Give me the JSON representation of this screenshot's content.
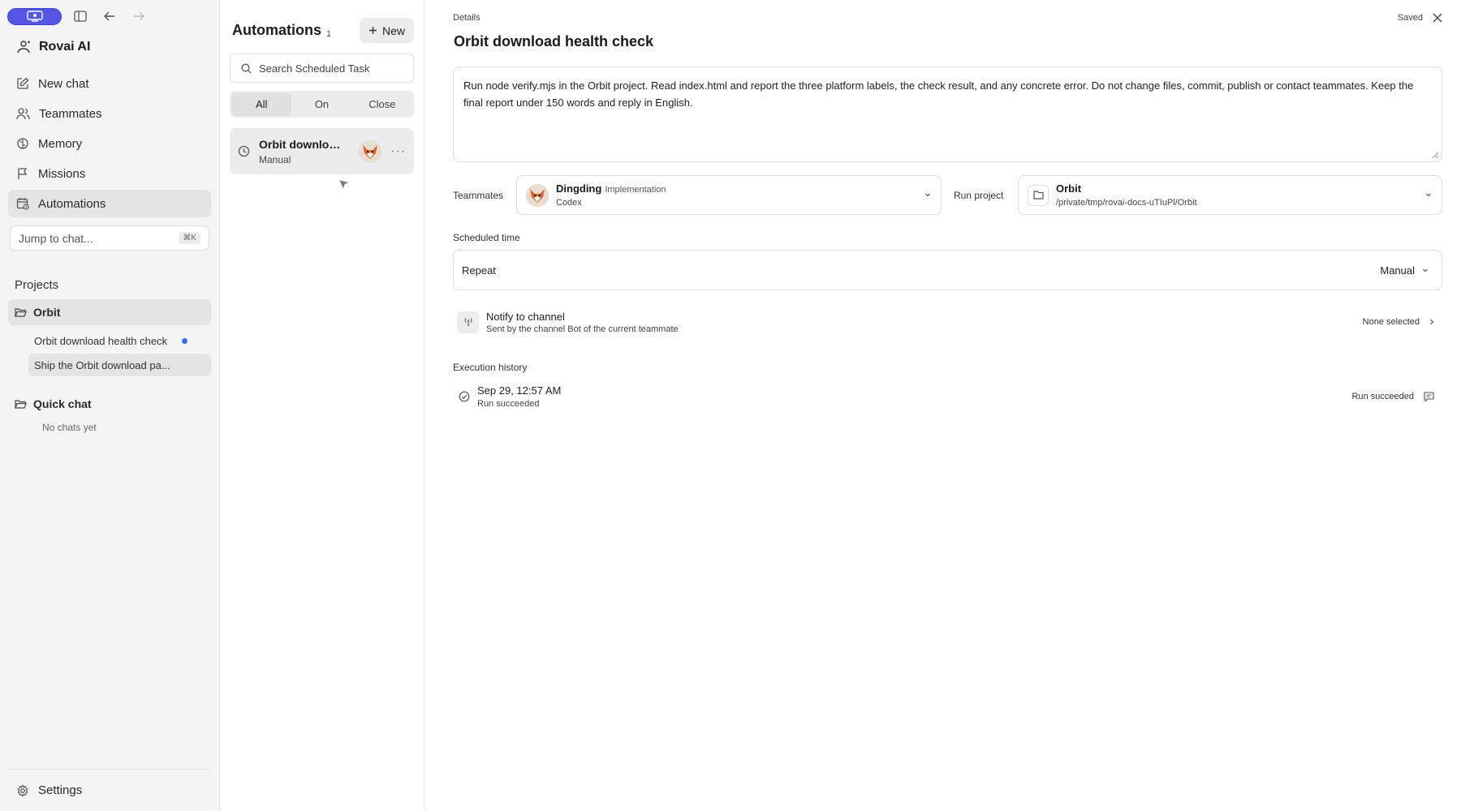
{
  "sidebar": {
    "brand": "Rovai AI",
    "nav": {
      "new_chat": "New chat",
      "teammates": "Teammates",
      "memory": "Memory",
      "missions": "Missions",
      "automations": "Automations"
    },
    "jump": {
      "label": "Jump to chat...",
      "shortcut": "⌘K"
    },
    "projects_title": "Projects",
    "projects": [
      {
        "name": "Orbit",
        "chats": [
          "Orbit download health check",
          "Ship the Orbit download pa..."
        ]
      },
      {
        "name": "Quick chat",
        "empty": "No chats yet"
      }
    ],
    "settings": "Settings"
  },
  "list": {
    "title": "Automations",
    "count": "1",
    "new_label": "New",
    "search_placeholder": "Search Scheduled Task",
    "filters": [
      "All",
      "On",
      "Close"
    ],
    "active_filter": "All",
    "items": [
      {
        "name": "Orbit download health check",
        "name_display": "Orbit downloa...",
        "schedule": "Manual"
      }
    ]
  },
  "detail": {
    "label": "Details",
    "saved": "Saved",
    "title": "Orbit download health check",
    "prompt": "Run node verify.mjs in the Orbit project. Read index.html and report the three platform labels, the check result, and any concrete error. Do not change files, commit, publish or contact teammates. Keep the final report under 150 words and reply in English.",
    "teammates_label": "Teammates",
    "teammate": {
      "name": "Dingding",
      "tag": "Implementation",
      "model": "Codex"
    },
    "run_project_label": "Run project",
    "project": {
      "name": "Orbit",
      "path": "/private/tmp/rovai-docs-uTIuPl/Orbit"
    },
    "scheduled_label": "Scheduled time",
    "repeat_label": "Repeat",
    "repeat_value": "Manual",
    "notify": {
      "title": "Notify to channel",
      "sub": "Sent by the channel Bot of the current teammate",
      "value": "None selected"
    },
    "history_label": "Execution history",
    "history": [
      {
        "date": "Sep 29, 12:57 AM",
        "sub": "Run succeeded",
        "status": "Run succeeded"
      }
    ]
  },
  "colors": {
    "accent": "#5456e8",
    "dot": "#2f6fe8",
    "sidebar_bg": "#f4f4f5"
  }
}
